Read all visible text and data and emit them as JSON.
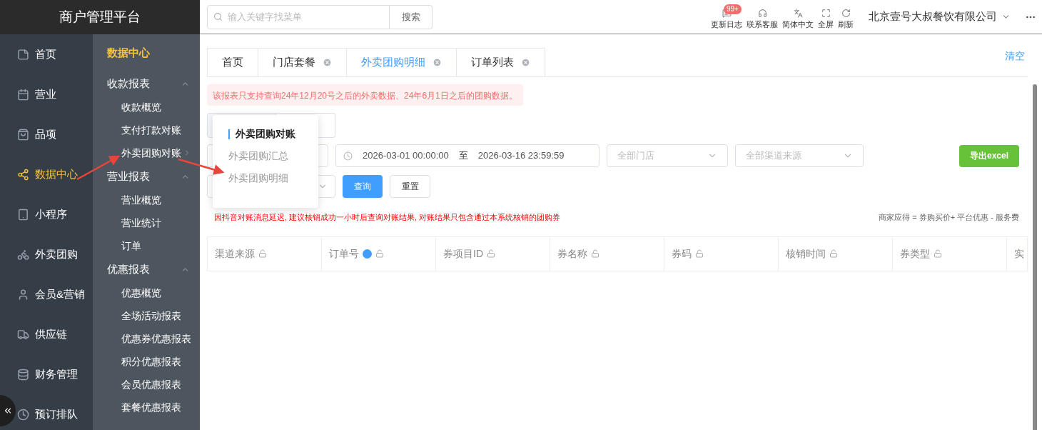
{
  "brand": "商户管理平台",
  "search": {
    "placeholder": "输入关键字找菜单",
    "button": "搜索"
  },
  "toolbar": [
    {
      "kind": "log",
      "label": "更新日志",
      "badge": "99+"
    },
    {
      "kind": "service",
      "label": "联系客服"
    },
    {
      "kind": "language",
      "label": "简体中文"
    },
    {
      "kind": "fullscreen",
      "label": "全屏"
    },
    {
      "kind": "refresh",
      "label": "刷新"
    }
  ],
  "company": "北京壹号大叔餐饮有限公司",
  "nav": [
    {
      "kind": "home",
      "label": "首页",
      "selected": false
    },
    {
      "kind": "business",
      "label": "营业",
      "selected": false
    },
    {
      "kind": "items",
      "label": "品项",
      "selected": false
    },
    {
      "kind": "data",
      "label": "数据中心",
      "selected": true
    },
    {
      "kind": "miniapp",
      "label": "小程序",
      "selected": false
    },
    {
      "kind": "delivery",
      "label": "外卖团购",
      "selected": false
    },
    {
      "kind": "member",
      "label": "会员&营销",
      "selected": false
    },
    {
      "kind": "supply",
      "label": "供应链",
      "selected": false
    },
    {
      "kind": "finance",
      "label": "财务管理",
      "selected": false
    },
    {
      "kind": "booking",
      "label": "预订排队",
      "selected": false
    }
  ],
  "submenu": {
    "title": "数据中心",
    "groups": [
      {
        "label": "收款报表",
        "expanded": true,
        "items": [
          {
            "label": "收款概览",
            "has_children": false
          },
          {
            "label": "支付打款对账",
            "has_children": false
          },
          {
            "label": "外卖团购对账",
            "has_children": true
          }
        ]
      },
      {
        "label": "营业报表",
        "expanded": true,
        "items": [
          {
            "label": "营业概览",
            "has_children": false
          },
          {
            "label": "营业统计",
            "has_children": false
          },
          {
            "label": "订单",
            "has_children": false
          }
        ]
      },
      {
        "label": "优惠报表",
        "expanded": true,
        "items": [
          {
            "label": "优惠概览",
            "has_children": false
          },
          {
            "label": "全场活动报表",
            "has_children": false
          },
          {
            "label": "优惠券优惠报表",
            "has_children": false
          },
          {
            "label": "积分优惠报表",
            "has_children": false
          },
          {
            "label": "会员优惠报表",
            "has_children": false
          },
          {
            "label": "套餐优惠报表",
            "has_children": false
          }
        ]
      }
    ]
  },
  "tabs": [
    {
      "label": "首页",
      "closable": false,
      "selected": false
    },
    {
      "label": "门店套餐",
      "closable": true,
      "selected": false
    },
    {
      "label": "外卖团购明细",
      "closable": true,
      "selected": true
    },
    {
      "label": "订单列表",
      "closable": true,
      "selected": false
    }
  ],
  "clear_link": "清空",
  "alert": "该报表只支持查询24年12月20号之后的外卖数据、24年6月1日之后的团购数据。",
  "popover": {
    "title": "外卖团购对账",
    "items": [
      "外卖团购汇总",
      "外卖团购明细"
    ]
  },
  "filters": {
    "date_start": "2026-03-01 00:00:00",
    "date_separator": "至",
    "date_end": "2026-03-16 23:59:59",
    "store_placeholder": "全部门店",
    "channel_placeholder": "全部渠道来源",
    "query": "查询",
    "reset": "重置",
    "export": "导出excel"
  },
  "note": "因抖音对账消息延迟, 建议核销成功一小时后查询对账结果, 对账结果只包含通过本系统核销的团购券",
  "formula": "商家应得 = 券购买价+ 平台优惠 - 服务费",
  "table": {
    "columns": [
      {
        "label": "渠道来源",
        "help": false
      },
      {
        "label": "订单号",
        "help": true
      },
      {
        "label": "券项目ID",
        "help": false
      },
      {
        "label": "券名称",
        "help": false
      },
      {
        "label": "券码",
        "help": false
      },
      {
        "label": "核销时间",
        "help": false
      },
      {
        "label": "券类型",
        "help": false
      },
      {
        "label": "实"
      }
    ]
  }
}
